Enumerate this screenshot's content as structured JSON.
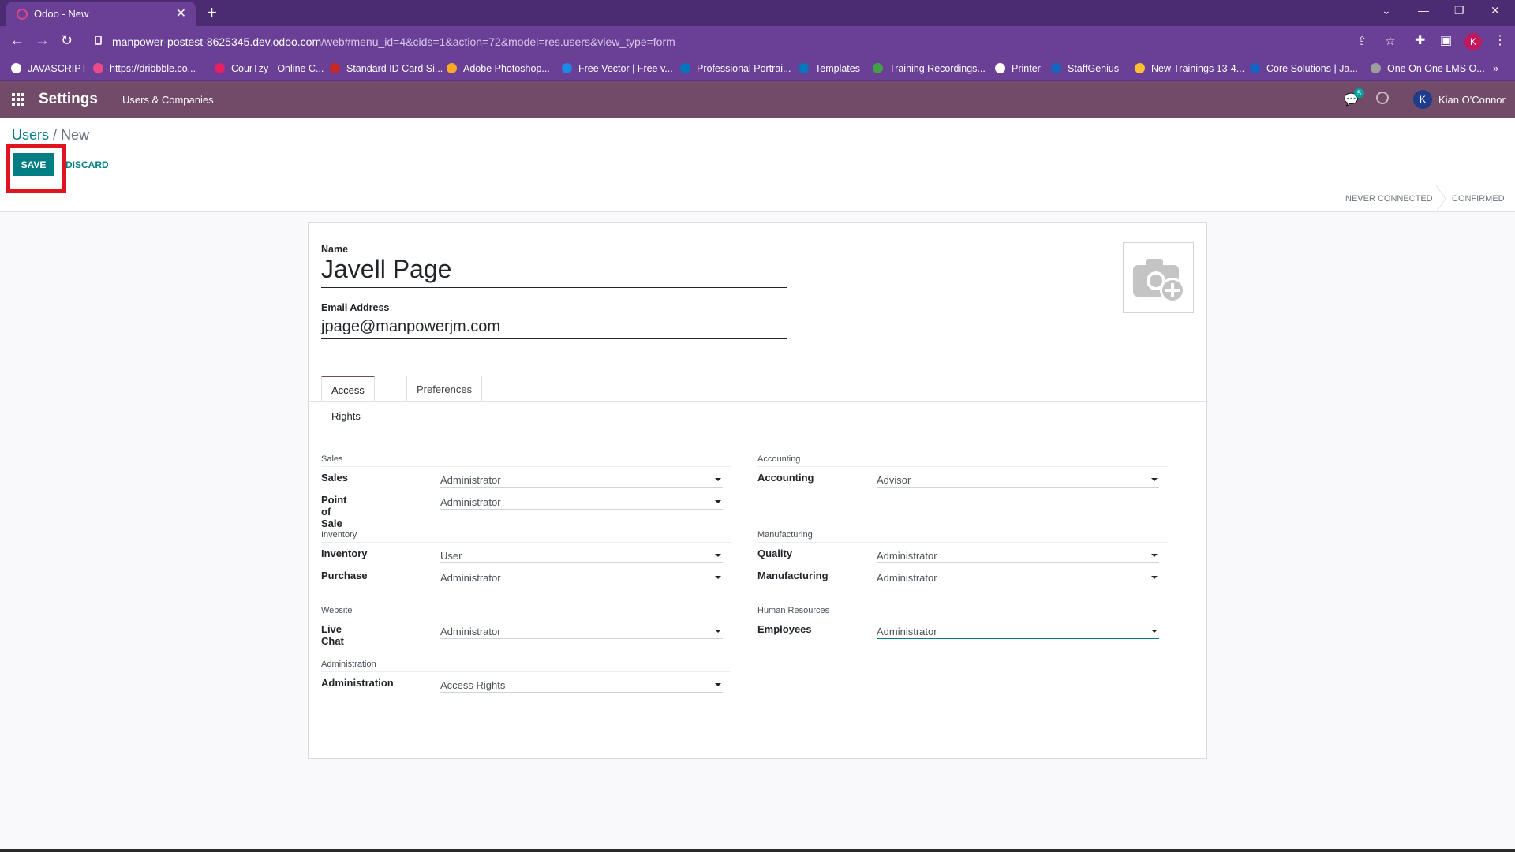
{
  "browser": {
    "tab_title": "Odoo - New",
    "url_host": "manpower-postest-8625345.dev.odoo.com",
    "url_path": "/web#menu_id=4&cids=1&action=72&model=res.users&view_type=form",
    "profile_initial": "K",
    "bookmarks": [
      {
        "label": "JAVASCRIPT",
        "color": "#ffffff"
      },
      {
        "label": "https://dribbble.co...",
        "color": "#ea4c89"
      },
      {
        "label": "CourTzy - Online C...",
        "color": "#e91e63"
      },
      {
        "label": "Standard ID Card Si...",
        "color": "#c62828"
      },
      {
        "label": "Adobe Photoshop...",
        "color": "#f9a825"
      },
      {
        "label": "Free Vector | Free v...",
        "color": "#1e88e5"
      },
      {
        "label": "Professional Portrai...",
        "color": "#0277bd"
      },
      {
        "label": "Templates",
        "color": "#0277bd"
      },
      {
        "label": "Training Recordings...",
        "color": "#43a047"
      },
      {
        "label": "Printer",
        "color": "#ffffff"
      },
      {
        "label": "StaffGenius",
        "color": "#1565c0"
      },
      {
        "label": "New Trainings 13-4...",
        "color": "#fbc02d"
      },
      {
        "label": "Core Solutions | Ja...",
        "color": "#1565c0"
      },
      {
        "label": "One On One LMS O...",
        "color": "#9e9e9e"
      }
    ]
  },
  "navbar": {
    "app_name": "Settings",
    "menu": "Users & Companies",
    "chat_count": "5",
    "user_initial": "K",
    "user_name": "Kian O'Connor"
  },
  "breadcrumb": {
    "parent": "Users",
    "separator": "/",
    "current": "New"
  },
  "buttons": {
    "save": "SAVE",
    "discard": "DISCARD"
  },
  "status": {
    "stage1": "NEVER CONNECTED",
    "stage2": "CONFIRMED"
  },
  "form": {
    "name_label": "Name",
    "name_value": "Javell Page",
    "email_label": "Email Address",
    "email_value": "jpage@manpowerjm.com",
    "tabs": [
      "Access Rights",
      "Preferences"
    ]
  },
  "groups": {
    "sales": {
      "title": "Sales",
      "rows": [
        {
          "label": "Sales",
          "value": "Administrator"
        },
        {
          "label": "Point of Sale",
          "value": "Administrator"
        }
      ]
    },
    "inventory": {
      "title": "Inventory",
      "rows": [
        {
          "label": "Inventory",
          "value": "User"
        },
        {
          "label": "Purchase",
          "value": "Administrator"
        }
      ]
    },
    "website": {
      "title": "Website",
      "rows": [
        {
          "label": "Live Chat",
          "value": "Administrator"
        }
      ]
    },
    "administration": {
      "title": "Administration",
      "rows": [
        {
          "label": "Administration",
          "value": "Access Rights"
        }
      ]
    },
    "accounting": {
      "title": "Accounting",
      "rows": [
        {
          "label": "Accounting",
          "value": "Advisor"
        }
      ]
    },
    "manufacturing": {
      "title": "Manufacturing",
      "rows": [
        {
          "label": "Quality",
          "value": "Administrator"
        },
        {
          "label": "Manufacturing",
          "value": "Administrator"
        }
      ]
    },
    "hr": {
      "title": "Human Resources",
      "rows": [
        {
          "label": "Employees",
          "value": "Administrator"
        }
      ]
    }
  },
  "colors": {
    "brand": "#714b67",
    "primary": "#017e84",
    "highlight": "#e0141e"
  }
}
